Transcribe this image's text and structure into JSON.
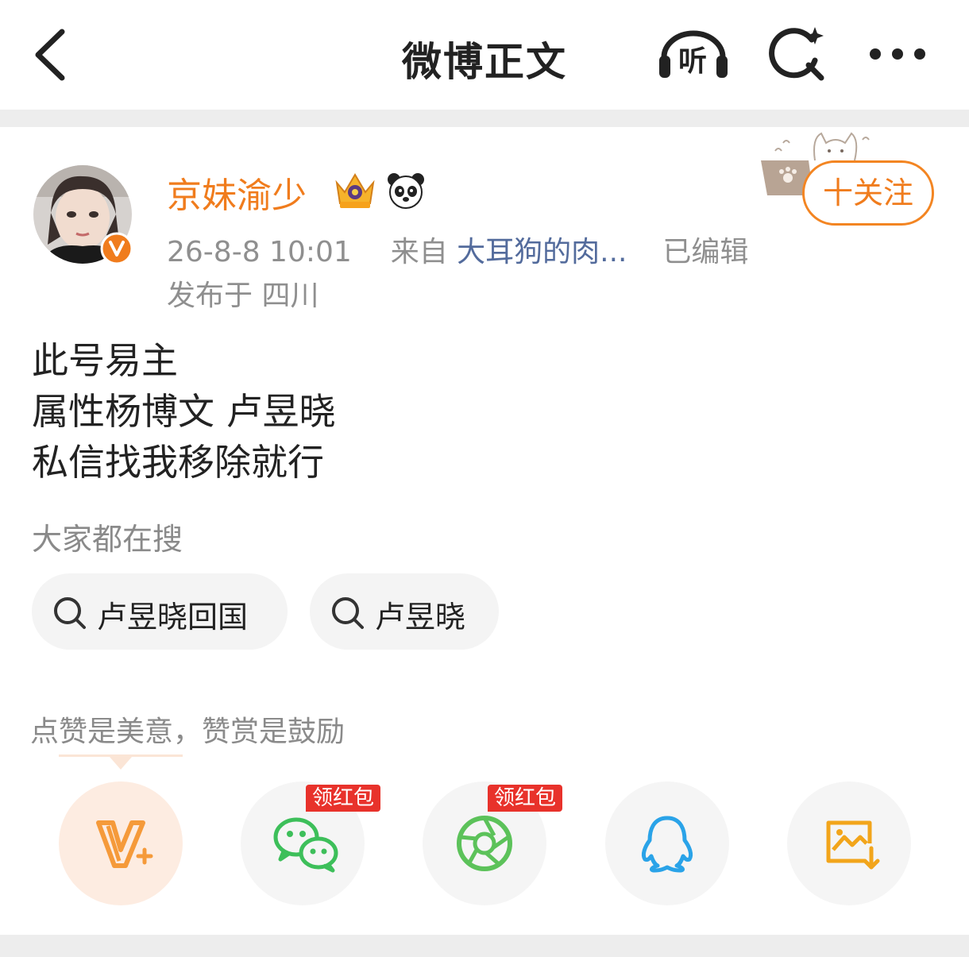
{
  "header": {
    "title": "微博正文",
    "listen_label": "听"
  },
  "post": {
    "author": "京妹渝少",
    "date": "26-8-8 10:01",
    "from_label": "来自",
    "source": "大耳狗的肉...",
    "edited": "已编辑",
    "location": "发布于 四川",
    "follow_label": "十关注",
    "lines": [
      "此号易主",
      "属性杨博文 卢昱晓",
      "私信找我移除就行"
    ]
  },
  "search": {
    "header": "大家都在搜",
    "chips": [
      "卢昱晓回国",
      "卢昱晓"
    ]
  },
  "reward": {
    "header": "点赞是美意，赞赏是鼓励",
    "badge1": "领红包",
    "badge2": "领红包"
  },
  "colors": {
    "accent": "#f07c1d",
    "link": "#536b9c",
    "wechat": "#3dbf5a",
    "qq": "#2aa3e8",
    "save": "#f2a51b",
    "badge": "#e8322b"
  }
}
